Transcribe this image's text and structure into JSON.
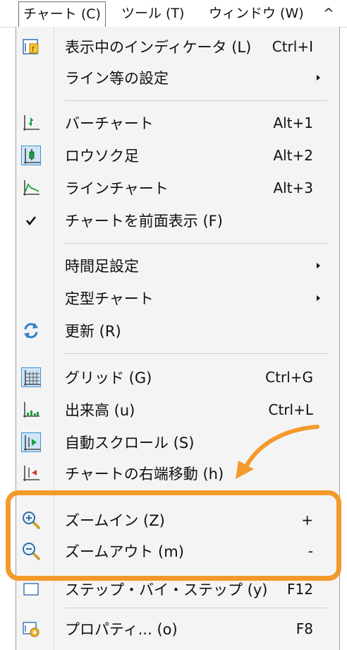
{
  "menubar": {
    "chart": "チャート (C)",
    "tools": "ツール (T)",
    "window": "ウィンドウ (W)",
    "more": "^"
  },
  "menu": {
    "indicators": {
      "label": "表示中のインディケータ (L)",
      "shortcut": "Ctrl+I"
    },
    "line_settings": {
      "label": "ライン等の設定"
    },
    "bar_chart": {
      "label": "バーチャート",
      "shortcut": "Alt+1"
    },
    "candlestick": {
      "label": "ロウソク足",
      "shortcut": "Alt+2"
    },
    "line_chart": {
      "label": "ラインチャート",
      "shortcut": "Alt+3"
    },
    "foreground": {
      "label": "チャートを前面表示 (F)"
    },
    "timeframe": {
      "label": "時間足設定"
    },
    "template": {
      "label": "定型チャート"
    },
    "refresh": {
      "label": "更新 (R)"
    },
    "grid": {
      "label": "グリッド (G)",
      "shortcut": "Ctrl+G"
    },
    "volume": {
      "label": "出来高 (u)",
      "shortcut": "Ctrl+L"
    },
    "autoscroll": {
      "label": "自動スクロール (S)"
    },
    "shift": {
      "label": "チャートの右端移動 (h)"
    },
    "zoom_in": {
      "label": "ズームイン (Z)",
      "shortcut": "+"
    },
    "zoom_out": {
      "label": "ズームアウト (m)",
      "shortcut": "-"
    },
    "step_back": {
      "label": "ステップ・バイ・ステップ (y)",
      "shortcut": "F12"
    },
    "properties": {
      "label": "プロパティ... (o)",
      "shortcut": "F8"
    }
  },
  "icons": {
    "indicators": "indicator-list-icon",
    "bar_chart": "bar-chart-icon",
    "candlestick": "candlestick-icon",
    "line_chart": "line-chart-icon",
    "foreground": "checkmark-icon",
    "refresh": "refresh-icon",
    "grid": "grid-icon",
    "volume": "volume-icon",
    "autoscroll": "autoscroll-icon",
    "shift": "chart-shift-icon",
    "zoom_in": "zoom-in-icon",
    "zoom_out": "zoom-out-icon",
    "properties": "properties-icon"
  },
  "colors": {
    "highlight": "#f39a2b",
    "icon_frame": "#3c8fd4",
    "icon_frame_fill": "#cfe5f7"
  }
}
